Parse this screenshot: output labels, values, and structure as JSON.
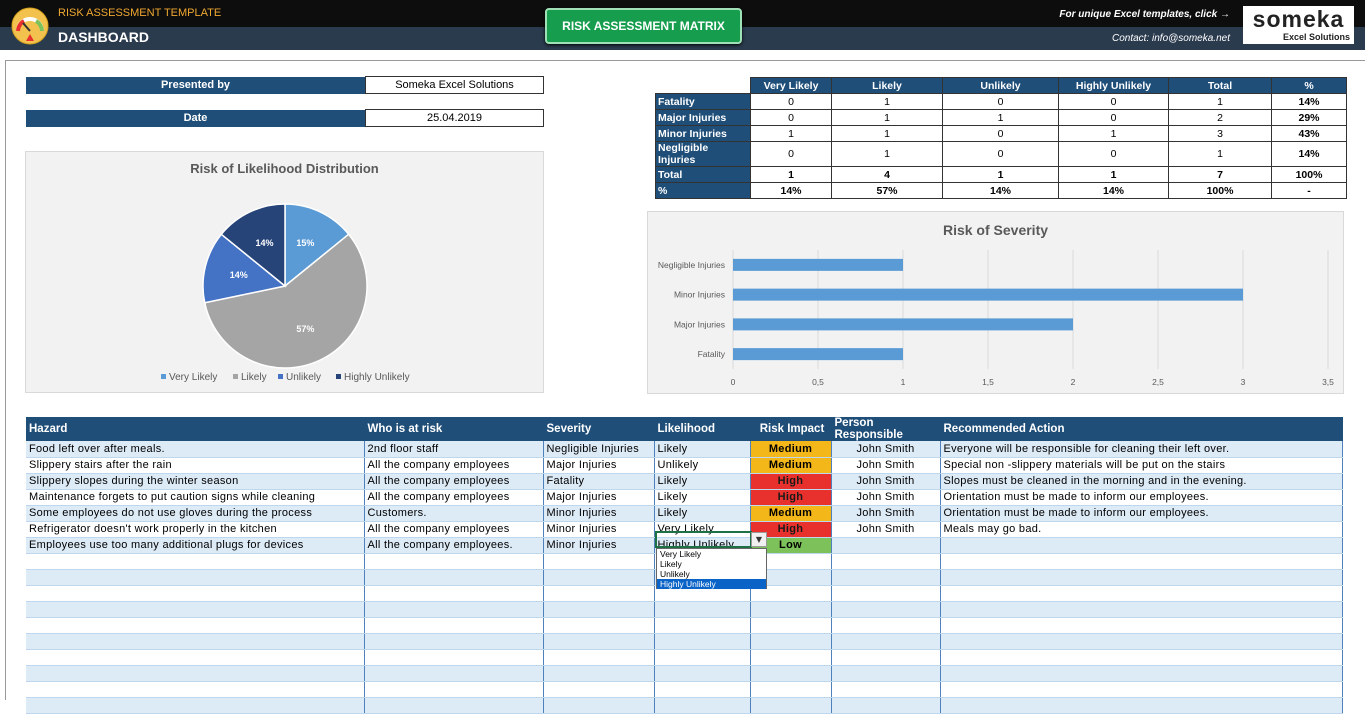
{
  "header": {
    "app_title": "RISK ASSESSMENT TEMPLATE",
    "page_title": "DASHBOARD",
    "matrix_button": "RISK ASSESSMENT MATRIX",
    "promo": "For unique Excel templates, click →",
    "contact": "Contact: info@someka.net",
    "logo_main": "someka",
    "logo_sub": "Excel Solutions"
  },
  "info": {
    "presented_by_label": "Presented by",
    "presented_by_value": "Someka Excel Solutions",
    "date_label": "Date",
    "date_value": "25.04.2019"
  },
  "summary": {
    "columns": [
      "",
      "Very Likely",
      "Likely",
      "Unlikely",
      "Highly Unlikely",
      "Total",
      "%"
    ],
    "rows": [
      [
        "Fatality",
        "0",
        "1",
        "0",
        "0",
        "1",
        "14%"
      ],
      [
        "Major Injuries",
        "0",
        "1",
        "1",
        "0",
        "2",
        "29%"
      ],
      [
        "Minor Injuries",
        "1",
        "1",
        "0",
        "1",
        "3",
        "43%"
      ],
      [
        "Negligible Injuries",
        "0",
        "1",
        "0",
        "0",
        "1",
        "14%"
      ],
      [
        "Total",
        "1",
        "4",
        "1",
        "1",
        "7",
        "100%"
      ],
      [
        "%",
        "14%",
        "57%",
        "14%",
        "14%",
        "100%",
        "-"
      ]
    ]
  },
  "chart_data": [
    {
      "type": "pie",
      "title": "Risk of Likelihood Distribution",
      "categories": [
        "Very Likely",
        "Likely",
        "Unlikely",
        "Highly Unlikely"
      ],
      "values": [
        14,
        57,
        14,
        14
      ],
      "labels": [
        "15%",
        "57%",
        "14%",
        "14%"
      ],
      "colors": [
        "#5b9bd5",
        "#a5a5a5",
        "#4472c4",
        "#264478"
      ],
      "legend": "bottom"
    },
    {
      "type": "bar",
      "orientation": "horizontal",
      "title": "Risk of Severity",
      "categories": [
        "Negligible Injuries",
        "Minor Injuries",
        "Major Injuries",
        "Fatality"
      ],
      "values": [
        1,
        3,
        2,
        1
      ],
      "xlim": [
        0,
        3.5
      ],
      "ticks": [
        "0",
        "0,5",
        "1",
        "1,5",
        "2",
        "2,5",
        "3",
        "3,5"
      ],
      "color": "#5b9bd5",
      "grid": true
    }
  ],
  "hazards": {
    "columns": [
      "Hazard",
      "Who is at risk",
      "Severity",
      "Likelihood",
      "Risk Impact",
      "Person Responsible",
      "Recommended Action"
    ],
    "rows": [
      {
        "hazard": "Food left over after meals.",
        "who": "2nd floor staff",
        "severity": "Negligible Injuries",
        "likelihood": "Likely",
        "impact": "Medium",
        "person": "John Smith",
        "action": "Everyone will be responsible for cleaning their left over."
      },
      {
        "hazard": "Slippery stairs after the rain",
        "who": "All the company employees",
        "severity": "Major Injuries",
        "likelihood": "Unlikely",
        "impact": "Medium",
        "person": "John Smith",
        "action": "Special non -slippery materials will be put on the stairs"
      },
      {
        "hazard": "Slippery slopes during the winter season",
        "who": "All the company employees",
        "severity": "Fatality",
        "likelihood": "Likely",
        "impact": "High",
        "person": "John Smith",
        "action": "Slopes must be cleaned in the morning and in the evening."
      },
      {
        "hazard": "Maintenance forgets to put caution signs while cleaning",
        "who": "All the company employees",
        "severity": "Major Injuries",
        "likelihood": "Likely",
        "impact": "High",
        "person": "John Smith",
        "action": "Orientation must be made to inform our employees."
      },
      {
        "hazard": "Some employees do not use gloves during the process",
        "who": "Customers.",
        "severity": "Minor Injuries",
        "likelihood": "Likely",
        "impact": "Medium",
        "person": "John Smith",
        "action": "Orientation must be made to inform our employees."
      },
      {
        "hazard": "Refrigerator doesn't work properly in the kitchen",
        "who": "All the company employees",
        "severity": "Minor Injuries",
        "likelihood": "Very Likely",
        "impact": "High",
        "person": "John Smith",
        "action": "Meals may go bad."
      },
      {
        "hazard": "Employees use too many additional plugs for  devices",
        "who": "All the company employees.",
        "severity": "Minor Injuries",
        "likelihood": "Highly Unlikely",
        "impact": "Low",
        "person": "",
        "action": ""
      }
    ],
    "empty_rows": 10
  },
  "dropdown": {
    "options": [
      "Very Likely",
      "Likely",
      "Unlikely",
      "Highly Unlikely"
    ],
    "selected": "Highly Unlikely"
  }
}
